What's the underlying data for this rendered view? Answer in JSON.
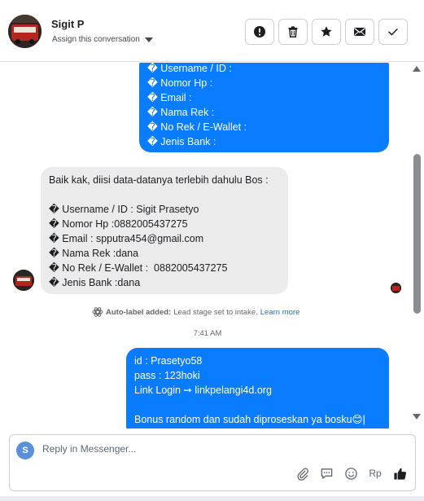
{
  "header": {
    "contact_name": "Sigit P",
    "assign_label": "Assign this conversation",
    "actions": [
      {
        "name": "mark-spam-button",
        "icon": "exclamation-circle-icon"
      },
      {
        "name": "delete-button",
        "icon": "trash-icon"
      },
      {
        "name": "star-button",
        "icon": "star-icon"
      },
      {
        "name": "mark-unread-button",
        "icon": "envelope-icon"
      },
      {
        "name": "mark-done-button",
        "icon": "checkmark-icon"
      }
    ]
  },
  "thread": {
    "outgoing_form": [
      "� Username / ID :",
      "� Nomor Hp :",
      "� Email :",
      "� Nama Rek :",
      "� No Rek / E-Wallet :",
      "� Jenis Bank :"
    ],
    "incoming": [
      "Baik kak, diisi data-datanya terlebih dahulu Bos :",
      "",
      "� Username / ID : Sigit Prasetyo",
      "� Nomor Hp :0882005437275",
      "� Email : spputra454@gmail.com",
      "� Nama Rek :dana",
      "� No Rek / E-Wallet :  0882005437275",
      "� Jenis Bank :dana"
    ],
    "system_note": {
      "bold": "Auto-label added:",
      "text": "Lead stage set to intake.",
      "link": "Learn more"
    },
    "timestamp": "7:41 AM",
    "outgoing_reply": [
      "id : Prasetyo58",
      "pass : 123hoki",
      "Link Login ➙ linkpelangi4d.org",
      "",
      "Bonus random dan sudah diproseskan ya bosku😊|"
    ]
  },
  "composer": {
    "avatar_letter": "S",
    "placeholder": "Reply in Messenger...",
    "tools": [
      "paperclip-icon",
      "saved-reply-icon",
      "emoji-icon",
      "Rp",
      "thumbs-up-icon"
    ]
  },
  "colors": {
    "outgoing_bubble": "#0a7cff",
    "incoming_bubble": "#ebebeb",
    "link": "#216fdb"
  }
}
